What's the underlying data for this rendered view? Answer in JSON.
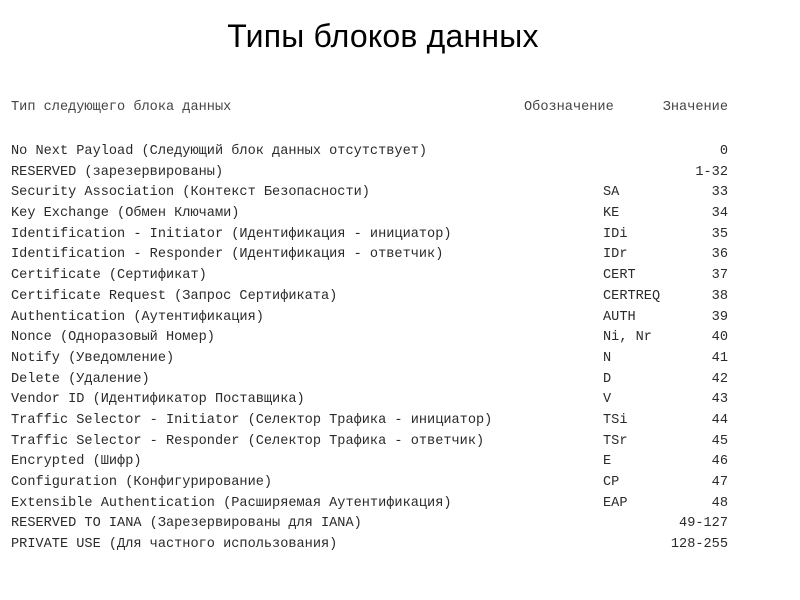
{
  "slide": {
    "title": "Типы блоков данных"
  },
  "table": {
    "headers": {
      "name": "Тип следующего блока данных",
      "abbr": "Обозначение",
      "value": "Значение"
    },
    "rows": [
      {
        "name": "No Next Payload (Следующий блок данных отсутствует)",
        "abbr": "",
        "value": "0"
      },
      {
        "name": "RESERVED (зарезервированы)",
        "abbr": "",
        "value": "1-32"
      },
      {
        "name": "Security Association (Контекст Безопасности)",
        "abbr": "SA",
        "value": "33"
      },
      {
        "name": "Key Exchange (Обмен Ключами)",
        "abbr": "KE",
        "value": "34"
      },
      {
        "name": "Identification - Initiator (Идентификация - инициатор)",
        "abbr": "IDi",
        "value": "35"
      },
      {
        "name": "Identification - Responder (Идентификация - ответчик)",
        "abbr": "IDr",
        "value": "36"
      },
      {
        "name": "Certificate (Сертификат)",
        "abbr": "CERT",
        "value": "37"
      },
      {
        "name": "Certificate Request (Запрос Сертификата)",
        "abbr": "CERTREQ",
        "value": "38"
      },
      {
        "name": "Authentication (Аутентификация)",
        "abbr": "AUTH",
        "value": "39"
      },
      {
        "name": "Nonce (Одноразовый Номер)",
        "abbr": "Ni, Nr",
        "value": "40"
      },
      {
        "name": "Notify (Уведомление)",
        "abbr": "N",
        "value": "41"
      },
      {
        "name": "Delete (Удаление)",
        "abbr": "D",
        "value": "42"
      },
      {
        "name": "Vendor ID (Идентификатор Поставщика)",
        "abbr": "V",
        "value": "43"
      },
      {
        "name": "Traffic Selector - Initiator (Селектор Трафика - инициатор)",
        "abbr": "TSi",
        "value": "44"
      },
      {
        "name": "Traffic Selector - Responder (Селектор Трафика - ответчик)",
        "abbr": "TSr",
        "value": "45"
      },
      {
        "name": "Encrypted (Шифр)",
        "abbr": "E",
        "value": "46"
      },
      {
        "name": "Configuration (Конфигурирование)",
        "abbr": "CP",
        "value": "47"
      },
      {
        "name": "Extensible Authentication (Расширяемая Аутентификация)",
        "abbr": "EAP",
        "value": "48"
      },
      {
        "name": "RESERVED TO IANA (Зарезервированы для IANA)",
        "abbr": "",
        "value": "49-127"
      },
      {
        "name": "PRIVATE USE (Для частного использования)",
        "abbr": "",
        "value": "128-255"
      }
    ]
  }
}
